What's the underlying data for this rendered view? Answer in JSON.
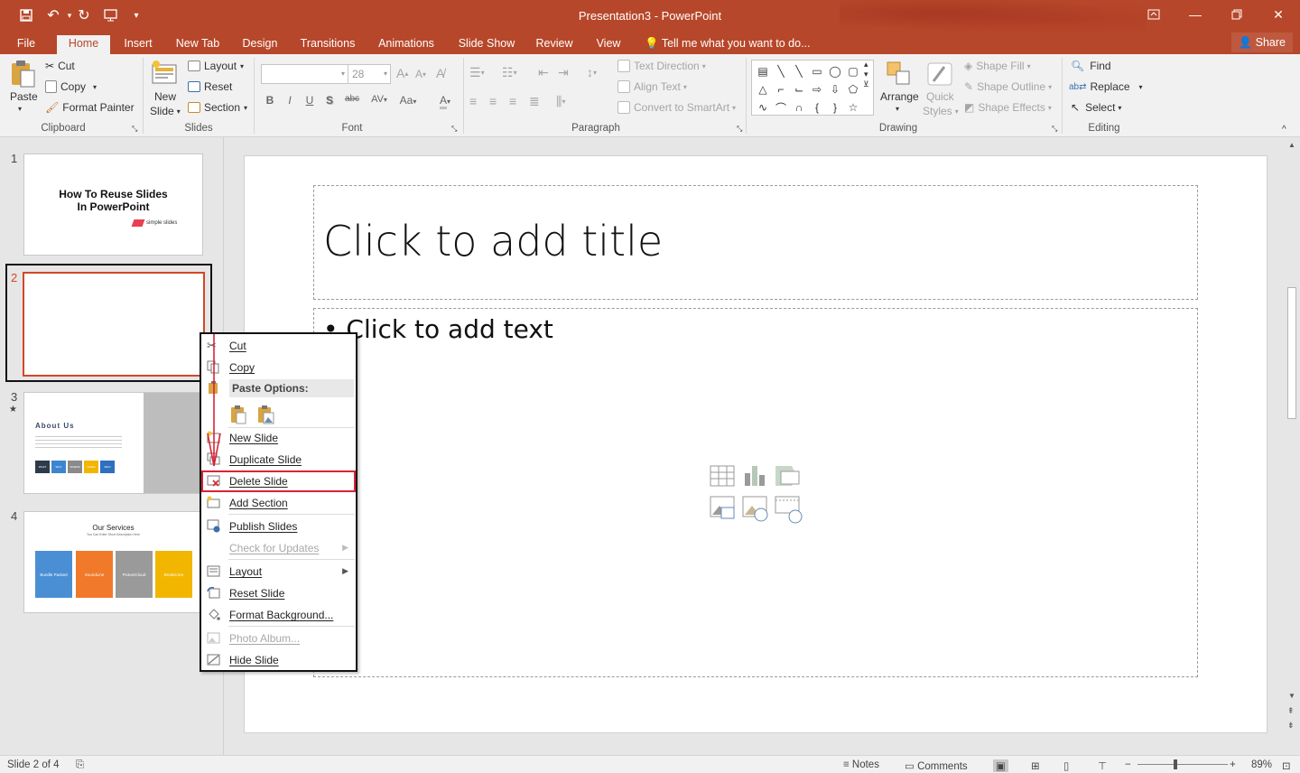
{
  "window": {
    "title": "Presentation3 - PowerPoint",
    "share_label": "Share"
  },
  "tabs": [
    {
      "label": "File"
    },
    {
      "label": "Home"
    },
    {
      "label": "Insert"
    },
    {
      "label": "New Tab"
    },
    {
      "label": "Design"
    },
    {
      "label": "Transitions"
    },
    {
      "label": "Animations"
    },
    {
      "label": "Slide Show"
    },
    {
      "label": "Review"
    },
    {
      "label": "View"
    }
  ],
  "tell_me": "Tell me what you want to do...",
  "ribbon": {
    "clipboard": {
      "paste": "Paste",
      "cut": "Cut",
      "copy": "Copy",
      "format_painter": "Format Painter",
      "label": "Clipboard"
    },
    "slides": {
      "new_slide_1": "New",
      "new_slide_2": "Slide",
      "layout": "Layout",
      "reset": "Reset",
      "section": "Section",
      "label": "Slides"
    },
    "font": {
      "size": "28",
      "label": "Font",
      "bold": "B",
      "italic": "I",
      "underline": "U",
      "shadow": "S",
      "strike": "abc",
      "spacing": "AV",
      "case": "Aa",
      "grow": "A",
      "shrink": "A"
    },
    "paragraph": {
      "text_direction": "Text Direction",
      "align_text": "Align Text",
      "convert_smartart": "Convert to SmartArt",
      "label": "Paragraph"
    },
    "drawing": {
      "arrange": "Arrange",
      "quick_styles_1": "Quick",
      "quick_styles_2": "Styles",
      "shape_fill": "Shape Fill",
      "shape_outline": "Shape Outline",
      "shape_effects": "Shape Effects",
      "label": "Drawing"
    },
    "editing": {
      "find": "Find",
      "replace": "Replace",
      "select": "Select",
      "label": "Editing"
    }
  },
  "thumbnails": [
    {
      "num": "1",
      "title_1": "How To Reuse Slides",
      "title_2": "In PowerPoint",
      "logo": "simple slides"
    },
    {
      "num": "2"
    },
    {
      "num": "3",
      "star": "★",
      "heading": "About Us",
      "tags": [
        "WHAT",
        "WHY",
        "WHERE",
        "WHEN",
        "WHO"
      ]
    },
    {
      "num": "4",
      "heading": "Our Services",
      "subheading": "You Can Enter Short Description Here",
      "cards": [
        "Bundle Packed",
        "SoundLine",
        "PictureCloud",
        "BreakCore"
      ]
    }
  ],
  "slide": {
    "title_placeholder": "Click to add title",
    "body_placeholder": "• Click to add text"
  },
  "context_menu": {
    "cut": "Cut",
    "copy": "Copy",
    "paste_options": "Paste Options:",
    "new_slide": "New Slide",
    "duplicate_slide": "Duplicate Slide",
    "delete_slide": "Delete Slide",
    "add_section": "Add Section",
    "publish_slides": "Publish Slides",
    "check_updates": "Check for Updates",
    "layout": "Layout",
    "reset_slide": "Reset Slide",
    "format_background": "Format Background...",
    "photo_album": "Photo Album...",
    "hide_slide": "Hide Slide"
  },
  "status": {
    "slide_count": "Slide 2 of 4",
    "notes": "Notes",
    "comments": "Comments",
    "zoom": "89%"
  },
  "colors": {
    "accent": "#b7472a",
    "selection": "#d24726",
    "highlight": "#d82535"
  }
}
